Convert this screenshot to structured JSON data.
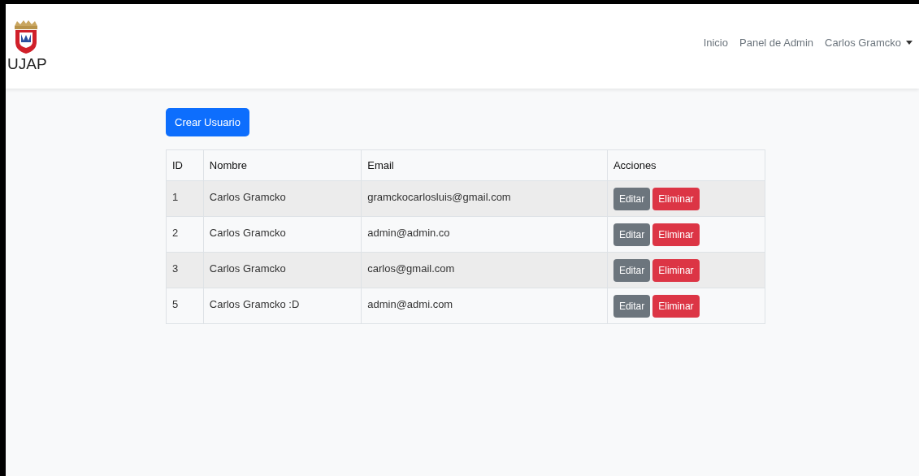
{
  "brand": {
    "name": "UJAP"
  },
  "nav": {
    "links": [
      "Inicio",
      "Panel de Admin"
    ],
    "user": "Carlos Gramcko"
  },
  "create_button": "Crear Usuario",
  "table": {
    "columns": [
      "ID",
      "Nombre",
      "Email",
      "Acciones"
    ],
    "rows": [
      {
        "id": "1",
        "name": "Carlos Gramcko",
        "email": "gramckocarlosluis@gmail.com",
        "actions": [
          "Editar",
          "Eliminar"
        ]
      },
      {
        "id": "2",
        "name": "Carlos Gramcko",
        "email": "admin@admin.co",
        "actions": [
          "Editar",
          "Eliminar"
        ]
      },
      {
        "id": "3",
        "name": "Carlos Gramcko",
        "email": "carlos@gmail.com",
        "actions": [
          "Editar",
          "Eliminar"
        ]
      },
      {
        "id": "5",
        "name": "Carlos Gramcko :D",
        "email": "admin@admi.com",
        "actions": [
          "Editar",
          "Eliminar"
        ]
      }
    ]
  }
}
